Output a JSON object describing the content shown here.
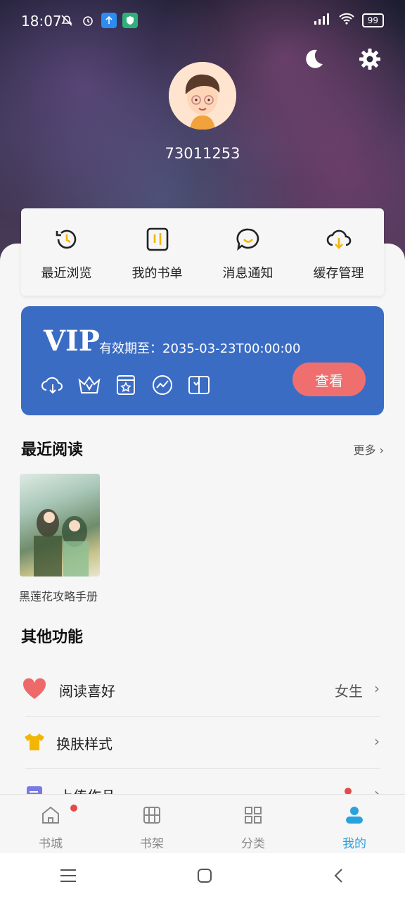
{
  "status": {
    "time": "18:07",
    "battery": "99"
  },
  "profile": {
    "user_id": "73011253"
  },
  "quick_actions": [
    {
      "label": "最近浏览",
      "icon": "history-icon"
    },
    {
      "label": "我的书单",
      "icon": "booklist-icon"
    },
    {
      "label": "消息通知",
      "icon": "message-icon"
    },
    {
      "label": "缓存管理",
      "icon": "cloud-download-icon"
    }
  ],
  "vip": {
    "title": "VIP",
    "expiry": "有效期至：2035-03-23T00:00:00",
    "button": "查看"
  },
  "recent": {
    "title": "最近阅读",
    "more": "更多",
    "books": [
      {
        "title": "黑莲花攻略手册"
      }
    ]
  },
  "other": {
    "title": "其他功能",
    "items": [
      {
        "label": "阅读喜好",
        "value": "女生"
      },
      {
        "label": "换肤样式",
        "value": ""
      },
      {
        "label": "上传作品",
        "value": ""
      }
    ]
  },
  "tabs": [
    {
      "label": "书城"
    },
    {
      "label": "书架"
    },
    {
      "label": "分类"
    },
    {
      "label": "我的"
    }
  ],
  "colors": {
    "vip_bg": "#3b6cc4",
    "vip_button": "#ef6f6f",
    "accent": "#2aa2dd",
    "badge": "#e34b4b",
    "icon_yellow": "#f2b705"
  }
}
